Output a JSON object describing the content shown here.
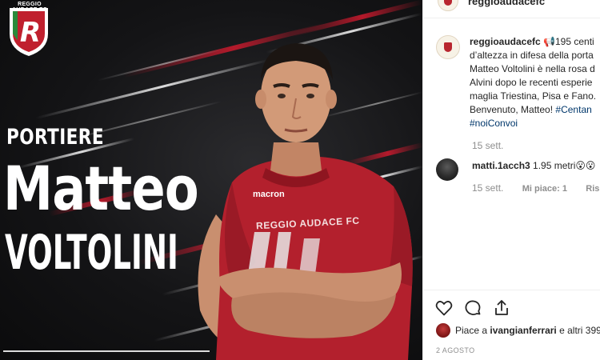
{
  "image": {
    "club_logo_text": "REGGIO AUDACE FC",
    "logo_letter": "R",
    "role": "PORTIERE",
    "first_name": "Matteo",
    "last_name": "VOLTOLINI",
    "shirt_sponsor": "macron",
    "shirt_text": "REGGIO AUDACE FC"
  },
  "header": {
    "username": "reggioaudacefc"
  },
  "caption": {
    "username": "reggioaudacefc",
    "lines": [
      "📢195 centi",
      "d’altezza in difesa della porta",
      "Matteo Voltolini è nella rosa d",
      "Alvini dopo le recenti esperie",
      "maglia Triestina, Pisa e Fano.",
      "Benvenuto, Matteo!",
      "#Centan",
      "#noiConvoi"
    ],
    "time": "15 sett."
  },
  "comment": {
    "username": "matti.1acch3",
    "text": "1.95 metri😮😮",
    "time": "15 sett.",
    "likes": "Mi piace: 1",
    "reply": "Rispond"
  },
  "likes_summary": {
    "prefix": "Piace a",
    "user": "ivangianferrari",
    "suffix": "e altri 399"
  },
  "post_date": "2 AGOSTO",
  "icons": [
    "heart-icon",
    "comment-icon",
    "share-icon"
  ],
  "colors": {
    "link": "#00376b",
    "meta": "#8e8e8e",
    "text": "#262626",
    "club_red": "#b8262f"
  }
}
